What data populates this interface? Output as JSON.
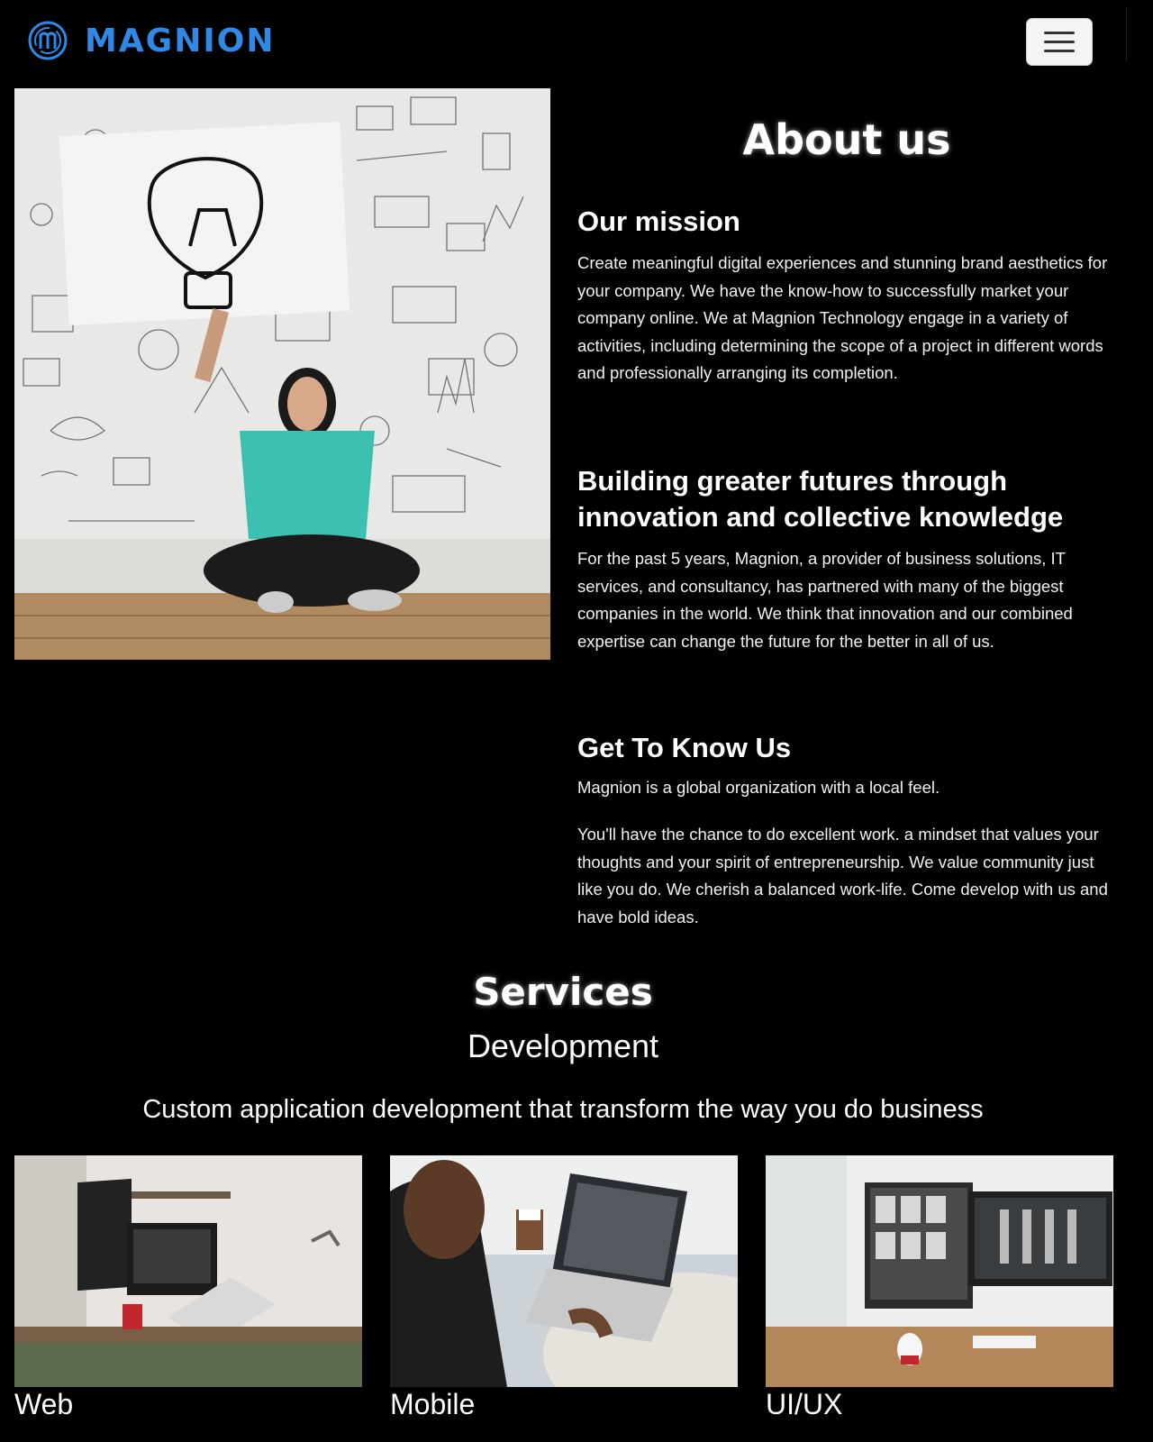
{
  "brand": {
    "name": "MAGNION",
    "color": "#2e8ae6"
  },
  "header": {
    "menu_icon": "hamburger-icon"
  },
  "about": {
    "title": "About us",
    "mission": {
      "heading": "Our mission",
      "text": "Create meaningful digital experiences and stunning brand aesthetics for your company. We have the know-how to successfully market your company online. We at Magnion Technology engage in a variety of activities, including determining the scope of a project in different words and professionally arranging its completion."
    },
    "futures": {
      "heading": "Building greater futures through innovation and collective knowledge",
      "text": "For the past 5 years, Magnion, a provider of business solutions, IT services, and consultancy, has partnered with many of the biggest companies in the world. We think that innovation and our combined expertise can change the future for the better in all of us."
    },
    "know": {
      "heading": "Get To Know Us",
      "text1": "Magnion is a global organization with a local feel.",
      "text2": "You'll have the chance to do excellent work. a mindset that values your thoughts and your spirit of entrepreneurship. We value community just like you do. We cherish a balanced work-life. Come develop with us and have bold ideas."
    }
  },
  "services": {
    "title": "Services",
    "subtitle": "Development",
    "tagline": "Custom application development that transform the way you do business",
    "cards": [
      {
        "label": "Web"
      },
      {
        "label": "Mobile"
      },
      {
        "label": "UI/UX"
      }
    ]
  }
}
